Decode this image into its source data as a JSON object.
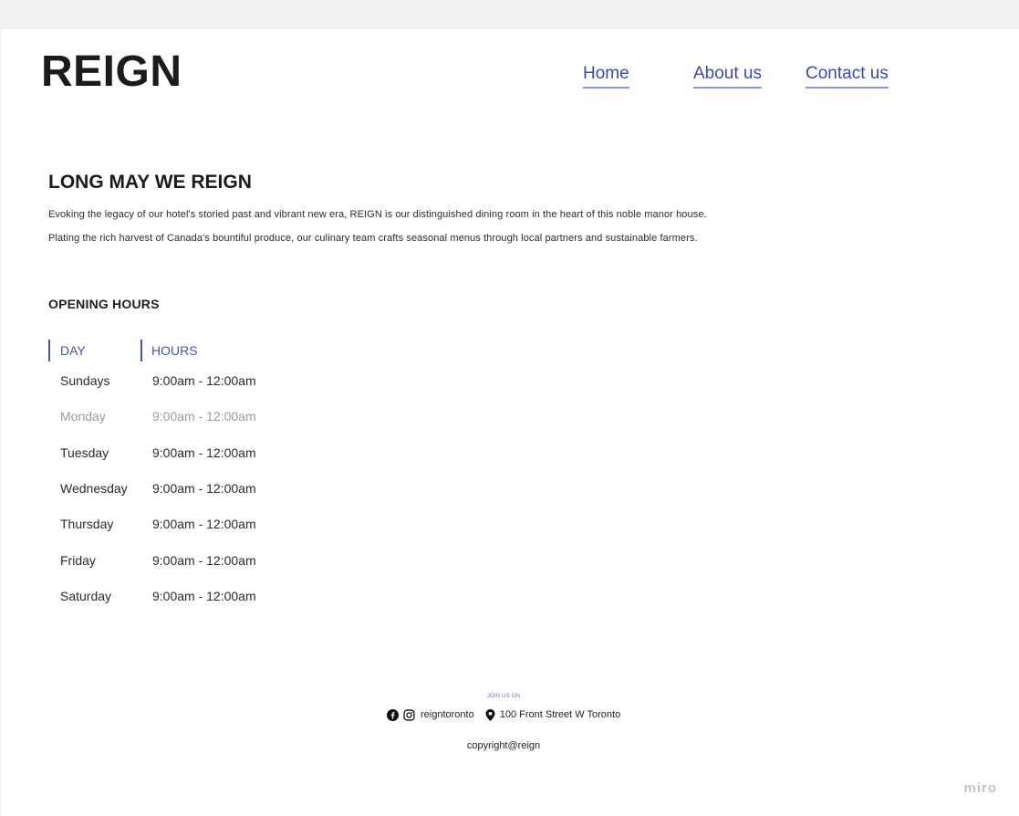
{
  "brand": {
    "name": "REIGN"
  },
  "nav": {
    "home": "Home",
    "about": "About us",
    "contact": "Contact us"
  },
  "hero": {
    "title": "LONG MAY WE REIGN",
    "p1": "Evoking the legacy of our hotel's storied past and vibrant new era, REIGN is our distinguished dining room in the heart of this noble manor house.",
    "p2": "Plating the rich harvest of Canada's bountiful produce, our culinary team crafts seasonal menus through local partners and sustainable farmers."
  },
  "hours": {
    "title": "OPENING HOURS",
    "headers": {
      "day": "DAY",
      "hours": "HOURS"
    },
    "rows": [
      {
        "day": "Sundays",
        "hours": "9:00am - 12:00am",
        "muted": false
      },
      {
        "day": "Monday",
        "hours": "9:00am - 12:00am",
        "muted": true
      },
      {
        "day": "Tuesday",
        "hours": "9:00am - 12:00am",
        "muted": false
      },
      {
        "day": "Wednesday",
        "hours": "9:00am - 12:00am",
        "muted": false
      },
      {
        "day": "Thursday",
        "hours": "9:00am - 12:00am",
        "muted": false
      },
      {
        "day": "Friday",
        "hours": "9:00am - 12:00am",
        "muted": false
      },
      {
        "day": "Saturday",
        "hours": "9:00am - 12:00am",
        "muted": false
      }
    ]
  },
  "footer": {
    "join_label": "JOIN US ON",
    "social_handle": "reigntoronto",
    "address": "100 Front Street W Toronto",
    "copyright": "copyright@reign",
    "icons": {
      "facebook": "facebook-icon",
      "instagram": "instagram-icon",
      "location": "map-pin-icon"
    }
  },
  "watermark": "miro",
  "colors": {
    "accent": "#4654a6",
    "underline": "#8e97d6",
    "text": "#1d1d1d",
    "muted": "#9b9b9b",
    "canvas": "#f1f1f1"
  }
}
